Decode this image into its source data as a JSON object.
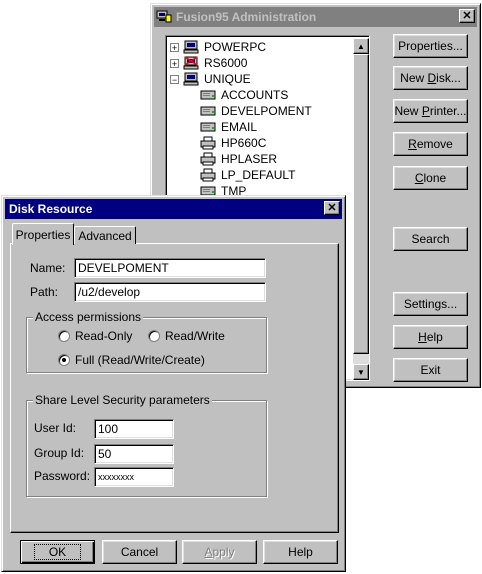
{
  "admin_window": {
    "title": "Fusion95 Administration",
    "close_glyph": "✕",
    "tree": [
      {
        "label": "POWERPC",
        "expander": "+",
        "icon": "computer-icon",
        "level": 0
      },
      {
        "label": "RS6000",
        "expander": "+",
        "icon": "computer-red-icon",
        "level": 0
      },
      {
        "label": "UNIQUE",
        "expander": "−",
        "icon": "computer-icon",
        "level": 0
      },
      {
        "label": "ACCOUNTS",
        "icon": "disk-icon",
        "level": 1
      },
      {
        "label": "DEVELPOMENT",
        "icon": "disk-icon",
        "level": 1
      },
      {
        "label": "EMAIL",
        "icon": "disk-icon",
        "level": 1
      },
      {
        "label": "HP660C",
        "icon": "printer-icon",
        "level": 1
      },
      {
        "label": "HPLASER",
        "icon": "printer-icon",
        "level": 1
      },
      {
        "label": "LP_DEFAULT",
        "icon": "printer-icon",
        "level": 1
      },
      {
        "label": "TMP",
        "icon": "disk-icon",
        "level": 1
      }
    ],
    "buttons": {
      "properties": "Properties...",
      "new_disk": "New Disk...",
      "new_printer": "New Printer...",
      "remove": "Remove",
      "clone": "Clone",
      "search": "Search",
      "settings": "Settings...",
      "help": "Help",
      "exit": "Exit"
    }
  },
  "disk_dialog": {
    "title": "Disk Resource",
    "close_glyph": "✕",
    "tabs": {
      "properties": "Properties",
      "advanced": "Advanced"
    },
    "name_label": "Name:",
    "name_value": "DEVELPOMENT",
    "path_label": "Path:",
    "path_value": "/u2/develop",
    "access_group_title": "Access permissions",
    "access_options": {
      "read_only": "Read-Only",
      "read_write": "Read/Write",
      "full": "Full (Read/Write/Create)"
    },
    "access_selected": "full",
    "security_group_title": "Share Level Security parameters",
    "user_id_label": "User Id:",
    "user_id_value": "100",
    "group_id_label": "Group Id:",
    "group_id_value": "50",
    "password_label": "Password:",
    "password_value": "xxxxxxxx",
    "buttons": {
      "ok": "OK",
      "cancel": "Cancel",
      "apply": "Apply",
      "help": "Help"
    }
  }
}
